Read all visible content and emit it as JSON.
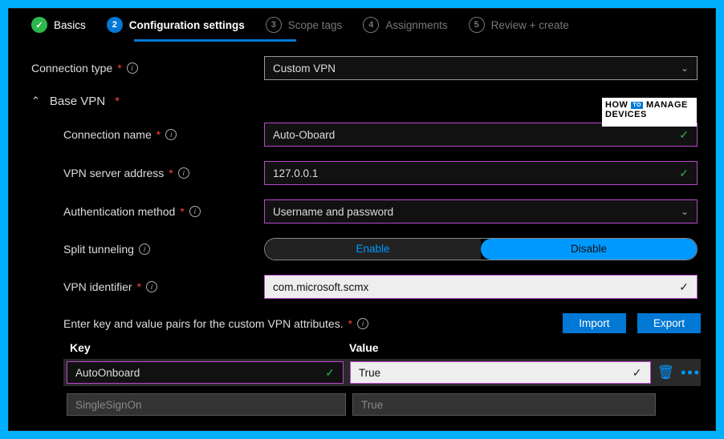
{
  "stepper": {
    "s1": {
      "label": "Basics"
    },
    "s2": {
      "num": "2",
      "label": "Configuration settings"
    },
    "s3": {
      "num": "3",
      "label": "Scope tags"
    },
    "s4": {
      "num": "4",
      "label": "Assignments"
    },
    "s5": {
      "num": "5",
      "label": "Review + create"
    }
  },
  "connType": {
    "label": "Connection type",
    "value": "Custom VPN"
  },
  "section": {
    "title": "Base VPN"
  },
  "fields": {
    "connName": {
      "label": "Connection name",
      "value": "Auto-Oboard"
    },
    "server": {
      "label": "VPN server address",
      "value": "127.0.0.1"
    },
    "auth": {
      "label": "Authentication method",
      "value": "Username and password"
    },
    "split": {
      "label": "Split tunneling",
      "enable": "Enable",
      "disable": "Disable"
    },
    "vpnid": {
      "label": "VPN identifier",
      "value": "com.microsoft.scmx"
    }
  },
  "kv": {
    "prompt": "Enter key and value pairs for the custom VPN attributes.",
    "importBtn": "Import",
    "exportBtn": "Export",
    "headKey": "Key",
    "headVal": "Value",
    "rows": [
      {
        "key": "AutoOnboard",
        "value": "True"
      },
      {
        "key": "SingleSignOn",
        "value": "True"
      }
    ]
  },
  "watermark": {
    "line1a": "HOW",
    "line1b": "MANAGE",
    "tag": "TO",
    "line2": "DEVICES"
  }
}
